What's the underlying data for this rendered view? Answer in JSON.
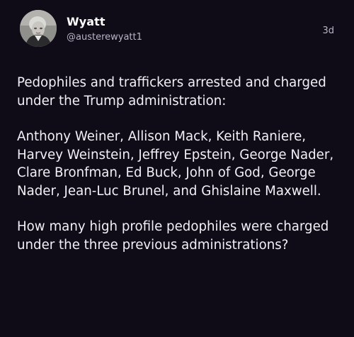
{
  "author": {
    "name": "Wyatt",
    "handle": "@austerewyatt1",
    "avatar_icon": "profile-photo"
  },
  "timestamp": "3d",
  "post": {
    "paragraphs": [
      "Pedophiles and traffickers arrested and charged under the Trump administration:",
      "Anthony Weiner, Allison Mack, Keith Raniere, Harvey Weinstein, Jeffrey Epstein, George Nader, Clare Bronfman, Ed Buck, John of God, George Nader, Jean-Luc Brunel, and Ghislaine Maxwell.",
      "How many high profile pedophiles were charged under the three previous administrations?"
    ]
  },
  "colors": {
    "background": "#0f0c18",
    "text": "#f2f0f6",
    "muted": "#b9b5c4"
  }
}
